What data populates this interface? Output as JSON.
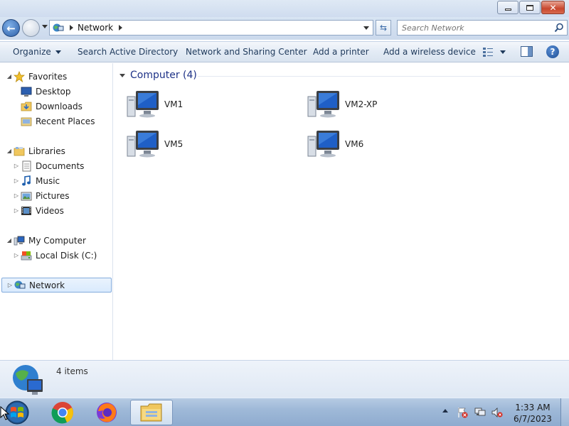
{
  "window": {
    "minimize_icon": "minimize-icon",
    "restore_icon": "restore-icon",
    "close_icon": "close-icon",
    "close_glyph": "✕"
  },
  "address": {
    "back_glyph": "←",
    "path_segment": "Network",
    "refresh_glyph": "⇆"
  },
  "search": {
    "placeholder": "Search Network"
  },
  "toolbar": {
    "organize_label": "Organize",
    "search_ad_label": "Search Active Directory",
    "network_sharing_label": "Network and Sharing Center",
    "add_printer_label": "Add a printer",
    "add_wireless_label": "Add a wireless device",
    "help_glyph": "?"
  },
  "sidebar": {
    "favorites": "Favorites",
    "desktop": "Desktop",
    "downloads": "Downloads",
    "recent_places": "Recent Places",
    "libraries": "Libraries",
    "documents": "Documents",
    "music": "Music",
    "pictures": "Pictures",
    "videos": "Videos",
    "my_computer": "My Computer",
    "local_disk": "Local Disk (C:)",
    "network": "Network"
  },
  "content": {
    "group_title": "Computer (4)",
    "computers": [
      "VM1",
      "VM2-XP",
      "VM5",
      "VM6"
    ]
  },
  "details": {
    "item_count": "4 items"
  },
  "taskbar": {
    "time": "1:33 AM",
    "date": "6/7/2023"
  },
  "colors": {
    "accent": "#1e3287",
    "selection_border": "#84acdd",
    "taskbar": "#9fb9d8"
  }
}
